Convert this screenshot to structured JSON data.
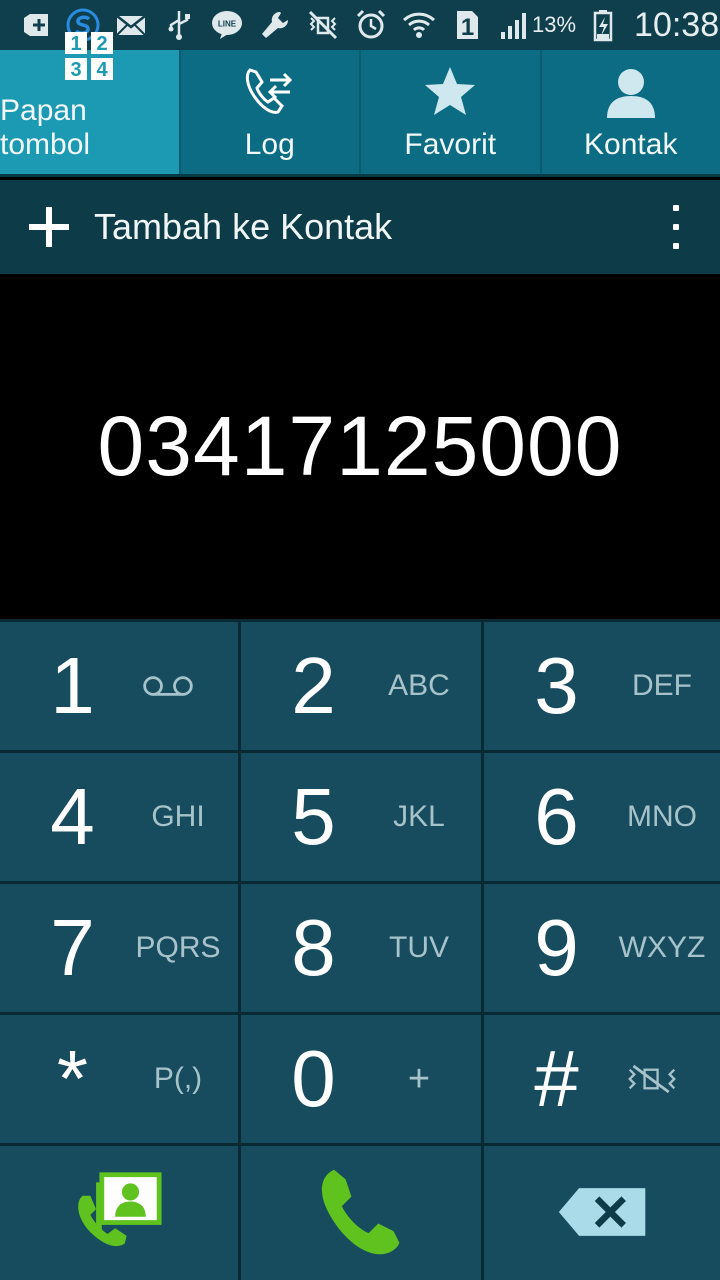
{
  "status_bar": {
    "icons_left": [
      "add-icon",
      "s-app-icon",
      "mail-icon",
      "usb-icon",
      "line-icon",
      "wrench-icon",
      "mute-icon",
      "alarm-icon",
      "wifi-icon",
      "sim-icon",
      "signal-icon"
    ],
    "sim_number": "1",
    "battery_percent": "13%",
    "time": "10:38"
  },
  "tabs": [
    {
      "label": "Papan tombol",
      "icon": "keypad-icon",
      "active": true
    },
    {
      "label": "Log",
      "icon": "call-log-icon",
      "active": false
    },
    {
      "label": "Favorit",
      "icon": "star-icon",
      "active": false
    },
    {
      "label": "Kontak",
      "icon": "contact-icon",
      "active": false
    }
  ],
  "action_bar": {
    "add_label": "Tambah ke Kontak"
  },
  "dialed_number": "03417125000",
  "keypad": {
    "k1": {
      "digit": "1",
      "letters": ""
    },
    "k2": {
      "digit": "2",
      "letters": "ABC"
    },
    "k3": {
      "digit": "3",
      "letters": "DEF"
    },
    "k4": {
      "digit": "4",
      "letters": "GHI"
    },
    "k5": {
      "digit": "5",
      "letters": "JKL"
    },
    "k6": {
      "digit": "6",
      "letters": "MNO"
    },
    "k7": {
      "digit": "7",
      "letters": "PQRS"
    },
    "k8": {
      "digit": "8",
      "letters": "TUV"
    },
    "k9": {
      "digit": "9",
      "letters": "WXYZ"
    },
    "kstar": {
      "digit": "*",
      "letters": "P(,)"
    },
    "k0": {
      "digit": "0",
      "letters": "+"
    },
    "khash": {
      "digit": "#",
      "letters": ""
    }
  },
  "colors": {
    "call_green": "#5fc21f",
    "tab_active": "#1d9ab3",
    "key_bg": "#164c5e"
  }
}
